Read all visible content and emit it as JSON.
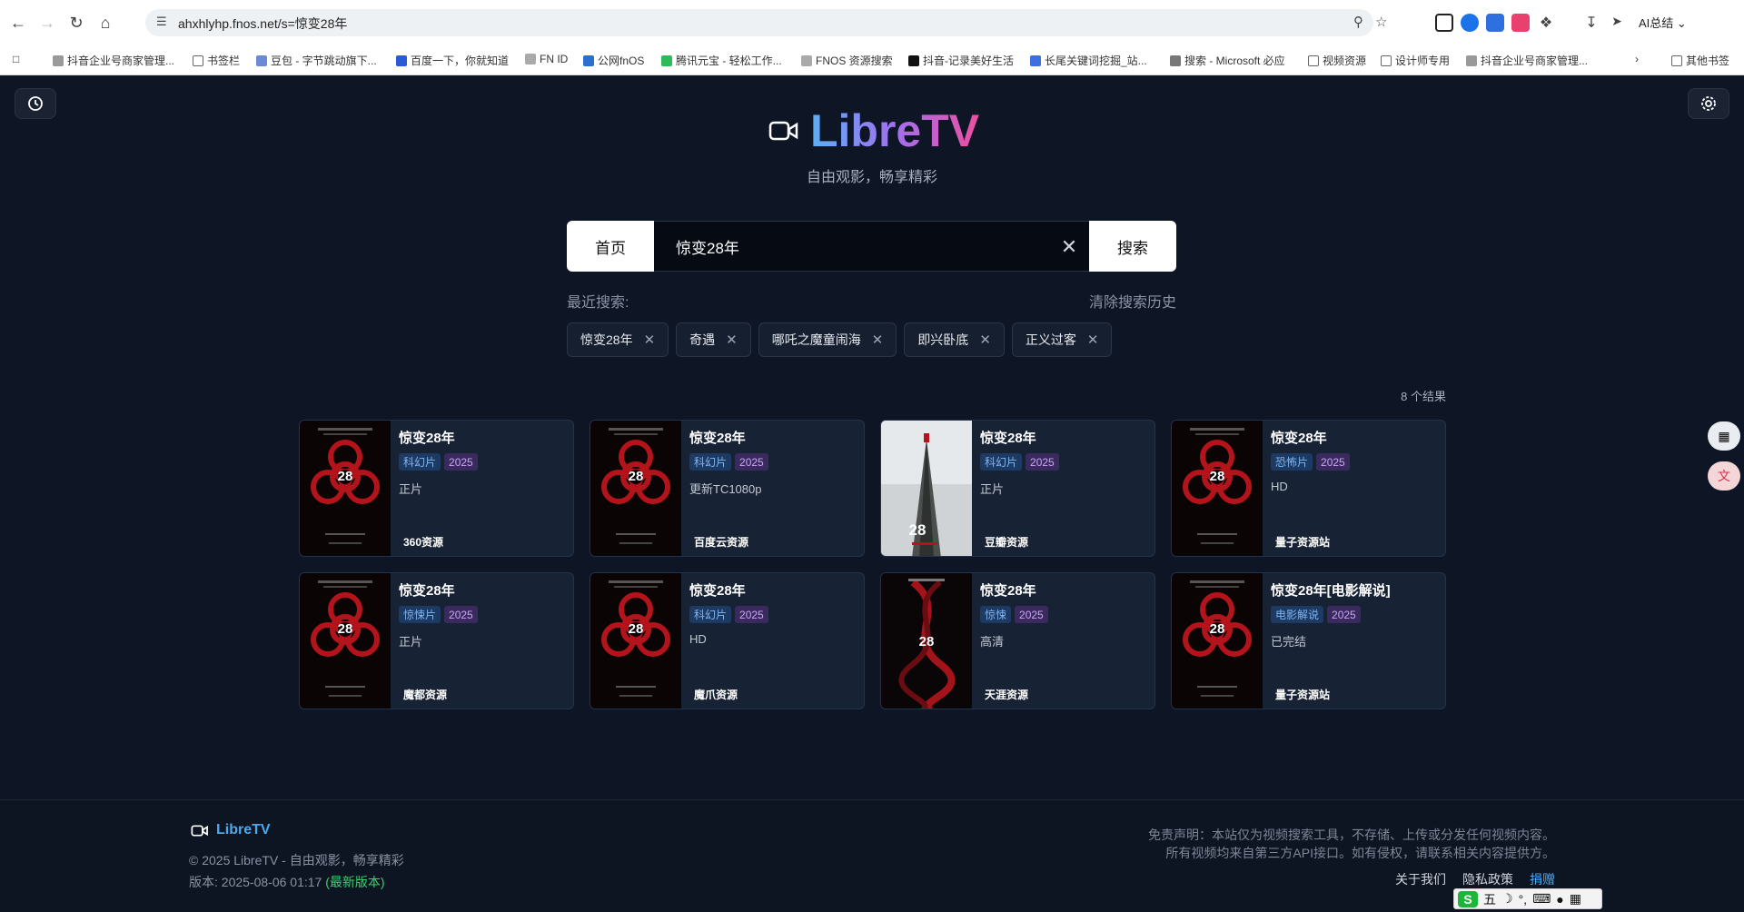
{
  "browser": {
    "url": "ahxhlyhp.fnos.net/s=惊变28年",
    "ai_label": "AI总结",
    "bookmarks": [
      "抖音企业号商家管理...",
      "书签栏",
      "豆包 - 字节跳动旗下...",
      "百度一下，你就知道",
      "FN ID",
      "公网fnOS",
      "腾讯元宝 - 轻松工作...",
      "FNOS 资源搜索",
      "抖音-记录美好生活",
      "长尾关键词挖掘_站...",
      "搜索 - Microsoft 必应",
      "视频资源",
      "设计师专用",
      "抖音企业号商家管理...",
      "其他书签"
    ]
  },
  "site": {
    "logo": "LibreTV",
    "tagline": "自由观影，畅享精彩",
    "accent_colors": [
      "#5ab0f5",
      "#a26ff0",
      "#ec4fa0"
    ]
  },
  "search": {
    "home_label": "首页",
    "value": "惊变28年",
    "button_label": "搜索"
  },
  "recent": {
    "label": "最近搜索:",
    "clear_label": "清除搜索历史",
    "items": [
      "惊变28年",
      "奇遇",
      "哪吒之魔童闹海",
      "即兴卧底",
      "正义过客"
    ]
  },
  "results": {
    "count_label": "8 个结果",
    "items": [
      {
        "title": "惊变28年",
        "genre": "科幻片",
        "year": "2025",
        "status": "正片",
        "source": "360资源",
        "poster": "biohazard"
      },
      {
        "title": "惊变28年",
        "genre": "科幻片",
        "year": "2025",
        "status": "更新TC1080p",
        "source": "百度云资源",
        "poster": "biohazard"
      },
      {
        "title": "惊变28年",
        "genre": "科幻片",
        "year": "2025",
        "status": "正片",
        "source": "豆瓣资源",
        "poster": "tower"
      },
      {
        "title": "惊变28年",
        "genre": "恐怖片",
        "year": "2025",
        "status": "HD",
        "source": "量子资源站",
        "poster": "biohazard"
      },
      {
        "title": "惊变28年",
        "genre": "惊悚片",
        "year": "2025",
        "status": "正片",
        "source": "魔都资源",
        "poster": "biohazard"
      },
      {
        "title": "惊变28年",
        "genre": "科幻片",
        "year": "2025",
        "status": "HD",
        "source": "魔爪资源",
        "poster": "biohazard"
      },
      {
        "title": "惊变28年",
        "genre": "惊悚",
        "year": "2025",
        "status": "高清",
        "source": "天涯资源",
        "poster": "dna"
      },
      {
        "title": "惊变28年[电影解说]",
        "genre": "电影解说",
        "year": "2025",
        "status": "已完结",
        "source": "量子资源站",
        "poster": "biohazard"
      }
    ]
  },
  "footer": {
    "logo": "LibreTV",
    "copyright": "© 2025 LibreTV - 自由观影，畅享精彩",
    "version_prefix": "版本: 2025-08-06 01:17 ",
    "version_latest": "(最新版本)",
    "disclaimer_1": "免责声明：本站仅为视频搜索工具，不存储、上传或分发任何视频内容。",
    "disclaimer_2": "所有视频均来自第三方API接口。如有侵权，请联系相关内容提供方。",
    "links": [
      "关于我们",
      "隐私政策",
      "捐赠"
    ]
  },
  "ime": {
    "mode": "五"
  }
}
